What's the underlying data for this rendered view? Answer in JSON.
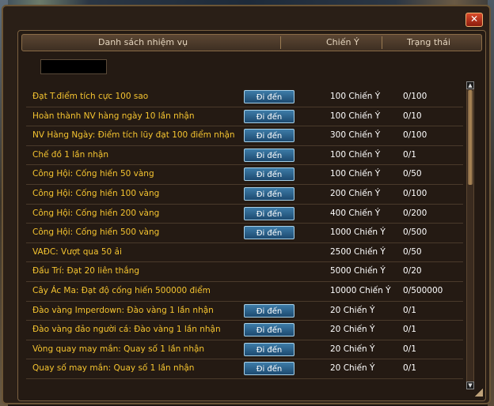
{
  "header": {
    "col_tasks": "Danh sách nhiệm vụ",
    "col_points": "Chiến Ý",
    "col_status": "Trạng thái"
  },
  "close_label": "✕",
  "tasks": [
    {
      "name": "Đạt T.điểm tích cực 100 sao",
      "button": "Đi đến",
      "points": "100 Chiến Ý",
      "status": "0/100"
    },
    {
      "name": "Hoàn thành NV hàng ngày 10 lần nhận",
      "button": "Đi đến",
      "points": "100 Chiến Ý",
      "status": "0/10"
    },
    {
      "name": "NV Hàng Ngày: Điểm tích lũy đạt 100 điểm nhận",
      "button": "Đi đến",
      "points": "300 Chiến Ý",
      "status": "0/100"
    },
    {
      "name": "Chế đồ 1 lần nhận",
      "button": "Đi đến",
      "points": "100 Chiến Ý",
      "status": "0/1"
    },
    {
      "name": "Công Hội: Cống hiến 50 vàng",
      "button": "Đi đến",
      "points": "100 Chiến Ý",
      "status": "0/50"
    },
    {
      "name": "Công Hội: Cống hiến 100 vàng",
      "button": "Đi đến",
      "points": "200 Chiến Ý",
      "status": "0/100"
    },
    {
      "name": "Công Hội: Cống hiến 200 vàng",
      "button": "Đi đến",
      "points": "400 Chiến Ý",
      "status": "0/200"
    },
    {
      "name": "Công Hội: Cống hiến 500 vàng",
      "button": "Đi đến",
      "points": "1000 Chiến Ý",
      "status": "0/500"
    },
    {
      "name": "VAĐC: Vượt qua 50 ải",
      "button": null,
      "points": "2500 Chiến Ý",
      "status": "0/50"
    },
    {
      "name": "Đấu Trí: Đạt 20 liên thắng",
      "button": null,
      "points": "5000 Chiến Ý",
      "status": "0/20"
    },
    {
      "name": "Cây Ác Ma: Đạt độ cống hiến 500000 điểm",
      "button": null,
      "points": "10000 Chiến Ý",
      "status": "0/500000"
    },
    {
      "name": "Đào vàng Imperdown: Đào vàng 1 lần nhận",
      "button": "Đi đến",
      "points": "20 Chiến Ý",
      "status": "0/1"
    },
    {
      "name": "Đào vàng đảo người cá: Đào vàng 1 lần nhận",
      "button": "Đi đến",
      "points": "20 Chiến Ý",
      "status": "0/1"
    },
    {
      "name": "Vòng quay may mắn: Quay số 1 lần nhận",
      "button": "Đi đến",
      "points": "20 Chiến Ý",
      "status": "0/1"
    },
    {
      "name": "Quay số may mắn: Quay số 1 lần nhận",
      "button": "Đi đến",
      "points": "20 Chiến Ý",
      "status": "0/1"
    }
  ],
  "icons": {
    "scroll_up": "▲",
    "scroll_down": "▼"
  }
}
